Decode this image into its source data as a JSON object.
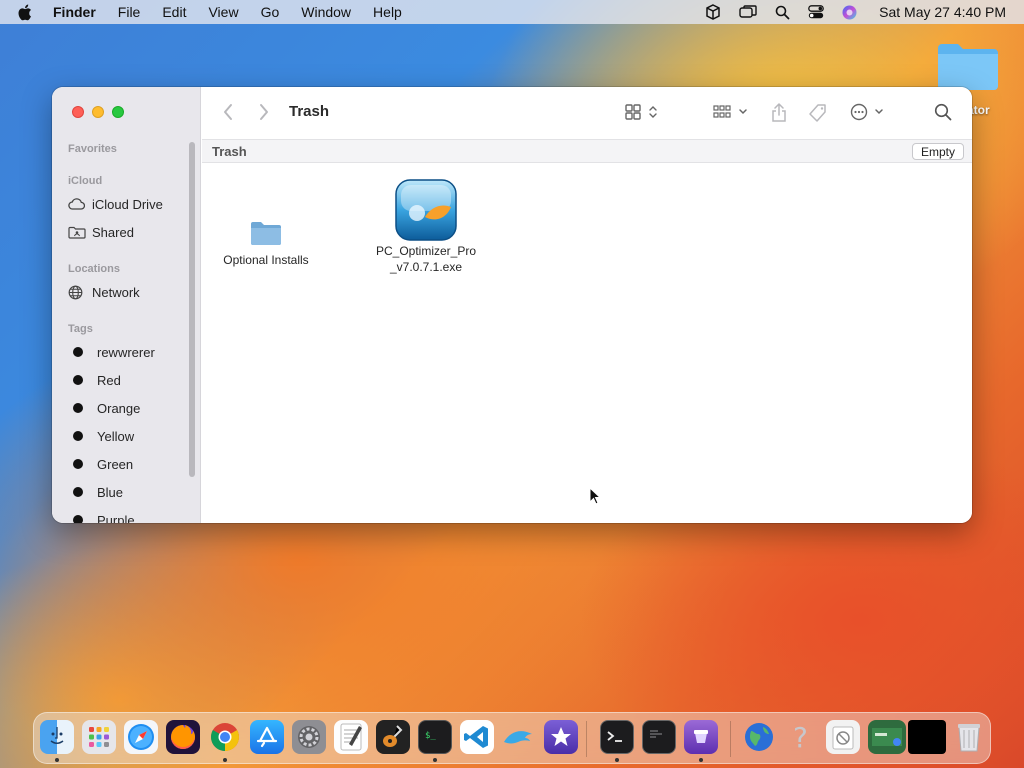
{
  "menubar": {
    "app_name": "Finder",
    "menus": [
      "File",
      "Edit",
      "View",
      "Go",
      "Window",
      "Help"
    ],
    "clock": "Sat May 27  4:40 PM",
    "status_icons": [
      "box-icon",
      "screen-mirror-icon",
      "spotlight-icon",
      "control-center-icon",
      "siri-icon"
    ]
  },
  "desktop": {
    "folder_label": "urator"
  },
  "window": {
    "title": "Trash",
    "path_label": "Trash",
    "empty_button": "Empty",
    "files": [
      {
        "name": "Optional Installs",
        "icon": "folder-icon"
      },
      {
        "name_line1": "PC_Optimizer_Pro",
        "name_line2": "_v7.0.7.1.exe",
        "icon": "app-installer-icon"
      }
    ]
  },
  "sidebar": {
    "favorites_header": "Favorites",
    "icloud_header": "iCloud",
    "icloud_items": [
      {
        "label": "iCloud Drive",
        "icon": "cloud-icon"
      },
      {
        "label": "Shared",
        "icon": "shared-folder-icon"
      }
    ],
    "locations_header": "Locations",
    "locations_items": [
      {
        "label": "Network",
        "icon": "globe-icon"
      }
    ],
    "tags_header": "Tags",
    "tags": [
      "rewwrerer",
      "Red",
      "Orange",
      "Yellow",
      "Green",
      "Blue",
      "Purple"
    ]
  },
  "dock": {
    "apps": [
      "finder",
      "launchpad",
      "safari",
      "firefox",
      "chrome",
      "app-store",
      "system-settings",
      "textedit",
      "garageband",
      "terminal-green",
      "vscode",
      "dolphin",
      "imovie",
      "terminal",
      "console",
      "simulator",
      "globe",
      "help",
      "script-editor",
      "screenshot",
      "black-app",
      "trash"
    ]
  },
  "colors": {
    "accent": "#0a84ff",
    "sidebar_bg": "#e8e7ec",
    "close": "#fe5f57",
    "minimize": "#febc2e",
    "maximize": "#28c840"
  }
}
